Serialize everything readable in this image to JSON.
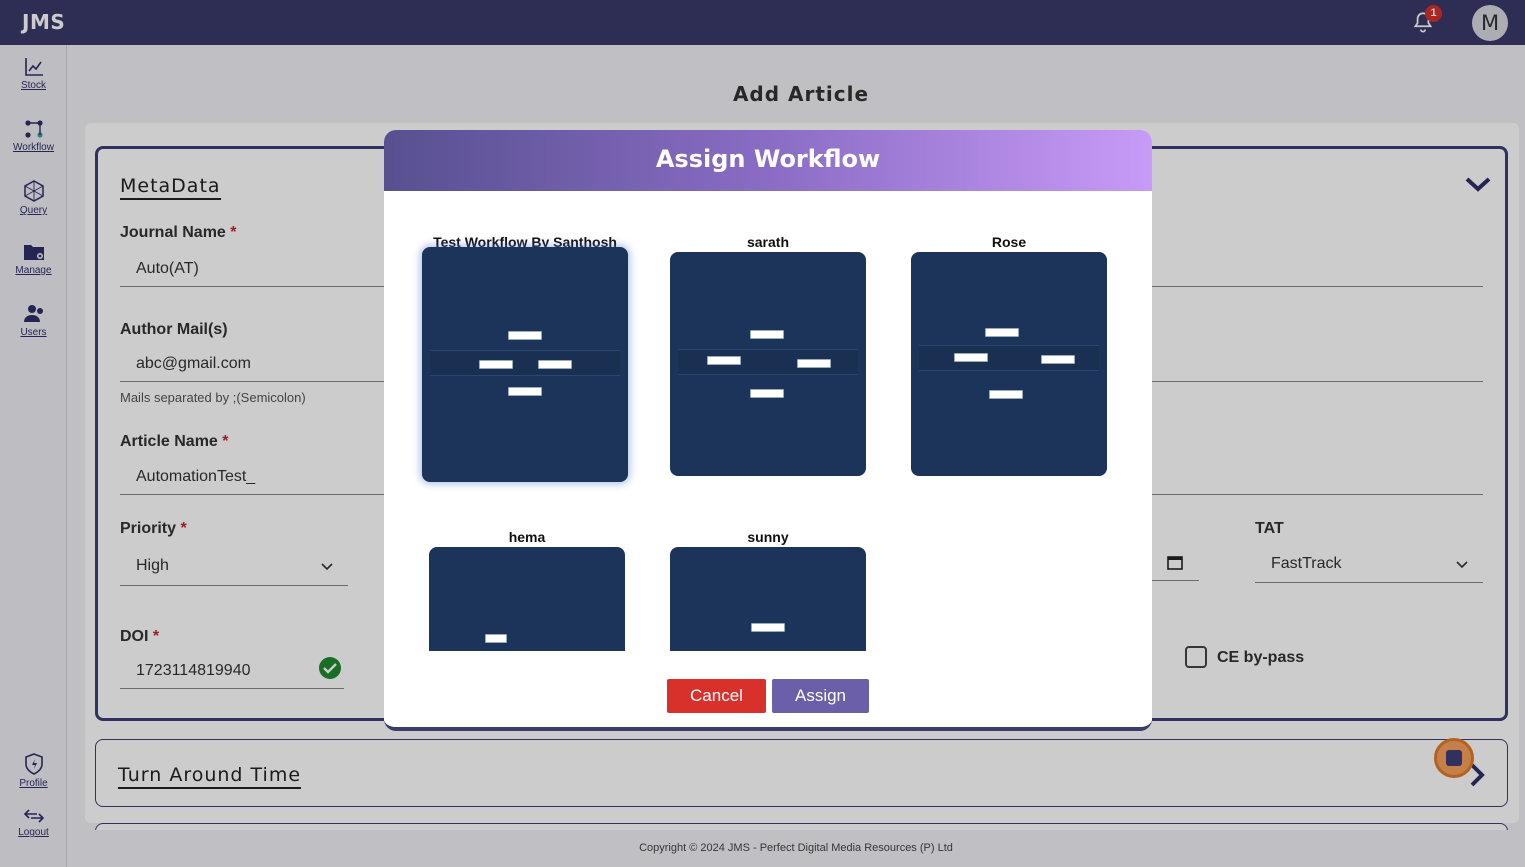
{
  "app": {
    "logo": "JMS",
    "notification_count": "1",
    "avatar_initial": "M"
  },
  "sidebar": {
    "items": [
      {
        "label": "Stock",
        "icon": "stock-chart-icon"
      },
      {
        "label": "Workflow",
        "icon": "workflow-icon"
      },
      {
        "label": "Query",
        "icon": "query-icon"
      },
      {
        "label": "Manage",
        "icon": "folder-manage-icon"
      },
      {
        "label": "Users",
        "icon": "users-icon"
      }
    ],
    "bottom_items": [
      {
        "label": "Profile",
        "icon": "shield-bolt-icon"
      },
      {
        "label": "Logout",
        "icon": "logout-icon"
      }
    ]
  },
  "page": {
    "title": "Add Article",
    "metadata_title": "MetaData",
    "fields": {
      "journal_name": {
        "label": "Journal Name",
        "required": "*",
        "value": "Auto(AT)"
      },
      "author_mails": {
        "label": "Author Mail(s)",
        "value": "abc@gmail.com",
        "hint": "Mails separated by ;(Semicolon)"
      },
      "article_name": {
        "label": "Article Name",
        "required": "*",
        "value": "AutomationTest_"
      },
      "priority": {
        "label": "Priority",
        "required": "*",
        "value": "High"
      },
      "tat": {
        "label": "TAT",
        "value": "FastTrack"
      },
      "doi": {
        "label": "DOI",
        "required": "*",
        "value": "1723114819940"
      },
      "ce_bypass": {
        "label": "CE by-pass",
        "checked": false
      }
    },
    "tat_section_title": "Turn Around Time"
  },
  "footer": {
    "copyright": "Copyright © 2024 JMS - Perfect Digital Media Resources (P) Ltd"
  },
  "modal": {
    "title": "Assign Workflow",
    "workflows": [
      {
        "name": "Test Workflow By Santhosh",
        "selected": true
      },
      {
        "name": "sarath",
        "selected": false
      },
      {
        "name": "Rose",
        "selected": false
      },
      {
        "name": "hema",
        "selected": false
      },
      {
        "name": "sunny",
        "selected": false
      }
    ],
    "cancel_label": "Cancel",
    "assign_label": "Assign"
  },
  "colors": {
    "topbar": "#3a3a6a",
    "accent": "#3c3c7a",
    "cancel": "#d8302a",
    "assign": "#6a5fa8",
    "thumbnail_bg": "#1c3459",
    "required": "#c0272d",
    "doi_valid": "#1f8a2e"
  }
}
